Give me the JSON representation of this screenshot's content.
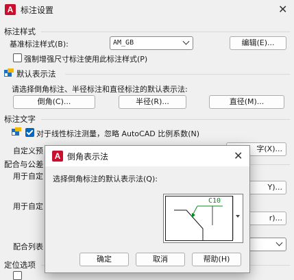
{
  "window": {
    "title": "标注设置",
    "app_icon_letter": "A"
  },
  "dim_style": {
    "section": "标注样式",
    "base_label": "基准标注样式(B):",
    "base_value": "AM_GB",
    "edit_button": "编辑(E)...",
    "force_checkbox": "强制增强尺寸标注使用此标注样式(P)",
    "force_checked": false
  },
  "default_repr": {
    "section": "默认表示法",
    "prompt": "请选择倒角标注、半径标注和直径标注的默认表示法:",
    "chamfer_button": "倒角(C)...",
    "radius_button": "半径(R)...",
    "diameter_button": "直径(M)..."
  },
  "dim_text": {
    "section": "标注文字",
    "linear_checkbox": "对于线性标注测量，忽略 AutoCAD 比例系数(N)",
    "linear_checked": true,
    "custom_prefix": "自定义预",
    "custom_button_tail": "字(X)..."
  },
  "fit_tolerance": {
    "section_prefix": "配合与公差",
    "row1_prefix": "用于自定",
    "row1_button_tail": "Y)...",
    "row2_prefix": "用于自定",
    "row2_button_tail": "r)...",
    "list_prefix": "配合列表"
  },
  "positioning": {
    "section": "定位选项"
  },
  "chamfer_dialog": {
    "title": "倒角表示法",
    "prompt": "选择倒角标注的默认表示法(Q):",
    "preview_label": "C10",
    "ok_button": "确定",
    "cancel_button": "取消",
    "help_button": "帮助(H)"
  },
  "colors": {
    "accent": "#0067c0",
    "brand": "#c8102e",
    "preview_label": "#008a1e"
  }
}
